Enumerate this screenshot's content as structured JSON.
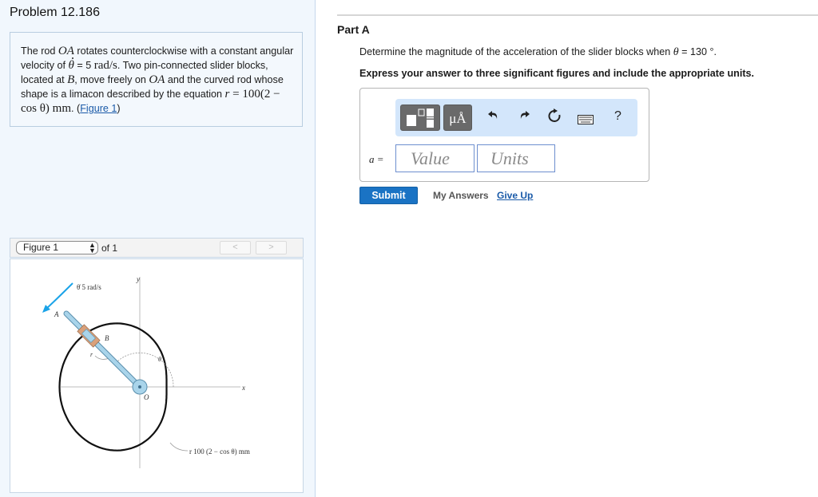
{
  "problem": {
    "title": "Problem 12.186",
    "text_parts": {
      "p1": "The rod ",
      "rod": "OA",
      "p2": " rotates counterclockwise with a constant angular velocity of ",
      "theta": "θ",
      "p3": " = 5 ",
      "units": "rad/s",
      "p4": ". Two pin-connected slider blocks, located at ",
      "point_b": "B",
      "p5": ", move freely on ",
      "rod2": "OA",
      "p6": " and the curved rod whose shape is a limacon described by the equation ",
      "eq_r": "r",
      "eq": " = 100(2 − cos θ) mm",
      "p7": ". (",
      "figure_link": "Figure 1",
      "p8": ")"
    }
  },
  "figure": {
    "selector_value": "Figure 1",
    "of_label": "of 1",
    "prev_label": "<",
    "next_label": ">",
    "labels": {
      "omega": "θ̇  5 rad/s",
      "y_axis": "y",
      "x_axis": "x",
      "point_a": "A",
      "point_b": "B",
      "point_o": "O",
      "r_label": "r",
      "theta_label": "θ",
      "curve_eq": "r  100 (2 − cos θ) mm"
    },
    "colors": {
      "arrow": "#1aa3e8",
      "rod": "#a9d4ea",
      "slider": "#d9a07a",
      "curve": "#111111"
    }
  },
  "part_a": {
    "title": "Part A",
    "question_prefix": "Determine the magnitude of the acceleration of the slider blocks when ",
    "question_theta": "θ",
    "question_suffix": " = 130 °.",
    "instruction": "Express your answer to three significant figures and include the appropriate units.",
    "toolbar": {
      "templates_icon": "templates-icon",
      "units_label": "μÅ",
      "undo_icon": "undo-icon",
      "redo_icon": "redo-icon",
      "reset_icon": "reset-icon",
      "keyboard_icon": "keyboard-icon",
      "help_label": "?"
    },
    "answer_label": "a =",
    "value_placeholder": "Value",
    "units_placeholder": "Units",
    "submit_label": "Submit",
    "my_answers_label": "My Answers",
    "give_up_label": "Give Up"
  }
}
